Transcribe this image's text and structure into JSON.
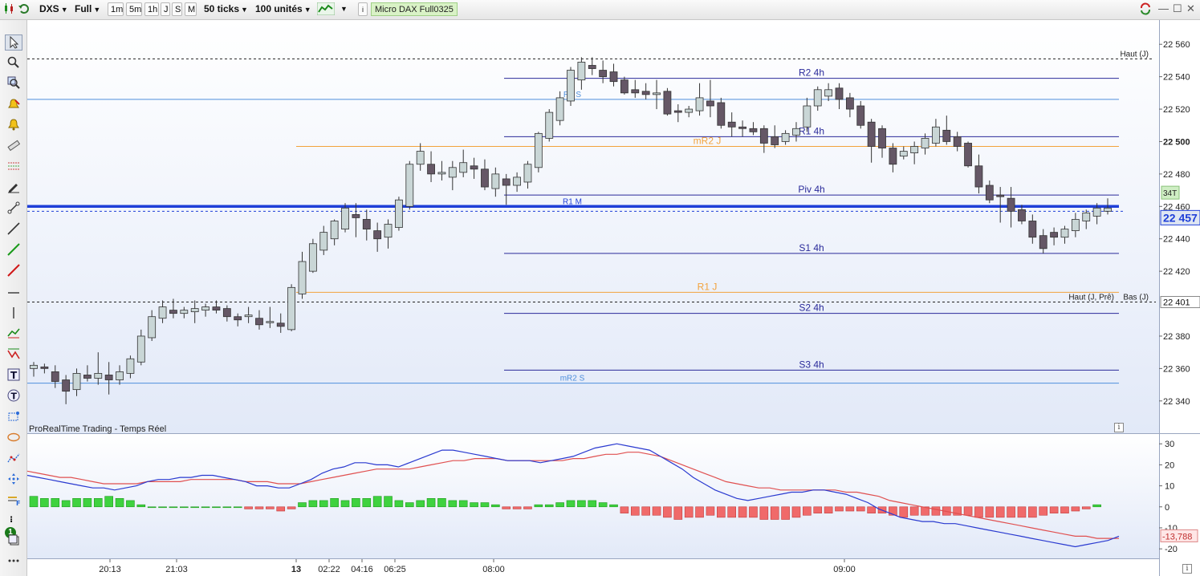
{
  "toolbar": {
    "symbol": "DXS",
    "range": "Full",
    "timeframes": [
      "1m",
      "5m",
      "1h",
      "J",
      "S",
      "M"
    ],
    "ticks": "50 ticks",
    "units": "100 unités",
    "instrument": "Micro DAX Full0325"
  },
  "chart": {
    "footer_label": "ProRealTime Trading - Temps Réel",
    "price_axis": {
      "ticks": [
        "22 560",
        "22 540",
        "22 520",
        "22 500",
        "22 480",
        "22 460",
        "22 440",
        "22 420",
        "22 380",
        "22 360",
        "22 340"
      ],
      "ymin": 22330,
      "ymax": 22570
    },
    "current_price": "22 457",
    "countdown": "34T",
    "low_marker": "22 401",
    "time_labels": [
      "20:13",
      "21:03",
      "13",
      "02:22",
      "04:16",
      "06:25",
      "08:00",
      "09:00"
    ],
    "levels": [
      {
        "label": "Haut (J)",
        "value": 22551,
        "color": "#222222",
        "style": "dashed"
      },
      {
        "label": "R2 4h",
        "value": 22539,
        "color": "#2a2a9a",
        "style": "solid"
      },
      {
        "label": "R2 S",
        "value": 22526,
        "color": "#4f8fdc",
        "style": "solid"
      },
      {
        "label": "R1 4h",
        "value": 22503,
        "color": "#2a2a9a",
        "style": "solid"
      },
      {
        "label": "mR2 J",
        "value": 22497,
        "color": "#f2a23c",
        "style": "solid"
      },
      {
        "label": "Piv 4h",
        "value": 22467,
        "color": "#2a2a9a",
        "style": "solid"
      },
      {
        "label": "R1 M",
        "value": 22460,
        "color": "#1f3fd8",
        "style": "thick"
      },
      {
        "label": "",
        "value": 22457,
        "color": "#1f3fd8",
        "style": "dashed"
      },
      {
        "label": "S1 4h",
        "value": 22431,
        "color": "#2a2a9a",
        "style": "solid"
      },
      {
        "label": "R1 J",
        "value": 22407,
        "color": "#f2a23c",
        "style": "solid"
      },
      {
        "label": "Haut (J, Prê)",
        "value": 22401,
        "color": "#222222",
        "style": "dashed"
      },
      {
        "label": "Bas (J)",
        "value": 22401,
        "color": "#222222",
        "style": "dashed"
      },
      {
        "label": "S2 4h",
        "value": 22394,
        "color": "#2a2a9a",
        "style": "solid"
      },
      {
        "label": "S3 4h",
        "value": 22359,
        "color": "#2a2a9a",
        "style": "solid"
      },
      {
        "label": "mR2 S",
        "value": 22351,
        "color": "#4f8fdc",
        "style": "solid"
      }
    ]
  },
  "indicator": {
    "axis_ticks": [
      "30",
      "20",
      "10",
      "0",
      "-10",
      "-20"
    ],
    "current_value": "-13,788",
    "ymin": -23,
    "ymax": 32
  },
  "chart_data": {
    "type": "candlestick",
    "ohlc": [
      [
        22360,
        22364,
        22355,
        22362
      ],
      [
        22361,
        22363,
        22357,
        22360
      ],
      [
        22358,
        22362,
        22348,
        22352
      ],
      [
        22353,
        22356,
        22338,
        22346
      ],
      [
        22347,
        22360,
        22343,
        22357
      ],
      [
        22356,
        22362,
        22352,
        22354
      ],
      [
        22354,
        22370,
        22350,
        22357
      ],
      [
        22356,
        22364,
        22344,
        22353
      ],
      [
        22353,
        22362,
        22350,
        22358
      ],
      [
        22357,
        22368,
        22354,
        22366
      ],
      [
        22364,
        22384,
        22362,
        22380
      ],
      [
        22379,
        22396,
        22377,
        22392
      ],
      [
        22391,
        22402,
        22388,
        22398
      ],
      [
        22396,
        22403,
        22391,
        22394
      ],
      [
        22394,
        22398,
        22391,
        22396
      ],
      [
        22395,
        22402,
        22388,
        22397
      ],
      [
        22396,
        22400,
        22392,
        22398
      ],
      [
        22398,
        22402,
        22394,
        22396
      ],
      [
        22397,
        22399,
        22389,
        22392
      ],
      [
        22392,
        22394,
        22386,
        22390
      ],
      [
        22392,
        22398,
        22388,
        22393
      ],
      [
        22391,
        22396,
        22384,
        22387
      ],
      [
        22389,
        22398,
        22385,
        22389
      ],
      [
        22388,
        22394,
        22382,
        22386
      ],
      [
        22384,
        22412,
        22383,
        22410
      ],
      [
        22406,
        22432,
        22403,
        22426
      ],
      [
        22420,
        22440,
        22419,
        22437
      ],
      [
        22433,
        22448,
        22430,
        22444
      ],
      [
        22440,
        22452,
        22436,
        22451
      ],
      [
        22446,
        22462,
        22444,
        22459
      ],
      [
        22455,
        22462,
        22441,
        22453
      ],
      [
        22452,
        22458,
        22439,
        22446
      ],
      [
        22445,
        22450,
        22432,
        22440
      ],
      [
        22441,
        22452,
        22434,
        22449
      ],
      [
        22447,
        22466,
        22445,
        22464
      ],
      [
        22460,
        22488,
        22458,
        22486
      ],
      [
        22486,
        22499,
        22482,
        22494
      ],
      [
        22486,
        22494,
        22475,
        22480
      ],
      [
        22480,
        22488,
        22476,
        22481
      ],
      [
        22478,
        22488,
        22470,
        22484
      ],
      [
        22481,
        22495,
        22478,
        22487
      ],
      [
        22485,
        22490,
        22477,
        22483
      ],
      [
        22483,
        22489,
        22470,
        22472
      ],
      [
        22471,
        22484,
        22466,
        22480
      ],
      [
        22477,
        22480,
        22461,
        22473
      ],
      [
        22473,
        22481,
        22469,
        22478
      ],
      [
        22475,
        22488,
        22471,
        22486
      ],
      [
        22484,
        22506,
        22481,
        22505
      ],
      [
        22502,
        22520,
        22500,
        22518
      ],
      [
        22513,
        22531,
        22510,
        22527
      ],
      [
        22525,
        22546,
        22522,
        22544
      ],
      [
        22538,
        22552,
        22532,
        22549
      ],
      [
        22547,
        22552,
        22541,
        22545
      ],
      [
        22544,
        22550,
        22536,
        22540
      ],
      [
        22543,
        22548,
        22534,
        22537
      ],
      [
        22538,
        22540,
        22529,
        22530
      ],
      [
        22532,
        22538,
        22527,
        22530
      ],
      [
        22531,
        22536,
        22526,
        22529
      ],
      [
        22529,
        22538,
        22520,
        22530
      ],
      [
        22531,
        22533,
        22516,
        22517
      ],
      [
        22519,
        22523,
        22512,
        22518
      ],
      [
        22518,
        22522,
        22515,
        22520
      ],
      [
        22519,
        22536,
        22516,
        22527
      ],
      [
        22525,
        22538,
        22515,
        22522
      ],
      [
        22524,
        22527,
        22508,
        22510
      ],
      [
        22512,
        22518,
        22503,
        22509
      ],
      [
        22509,
        22513,
        22503,
        22508
      ],
      [
        22508,
        22512,
        22504,
        22506
      ],
      [
        22508,
        22510,
        22493,
        22499
      ],
      [
        22503,
        22510,
        22496,
        22498
      ],
      [
        22500,
        22507,
        22498,
        22505
      ],
      [
        22504,
        22512,
        22500,
        22508
      ],
      [
        22509,
        22527,
        22506,
        22522
      ],
      [
        22522,
        22534,
        22519,
        22532
      ],
      [
        22528,
        22536,
        22525,
        22532
      ],
      [
        22533,
        22536,
        22520,
        22526
      ],
      [
        22527,
        22530,
        22515,
        22520
      ],
      [
        22522,
        22525,
        22508,
        22510
      ],
      [
        22512,
        22514,
        22487,
        22497
      ],
      [
        22508,
        22510,
        22490,
        22496
      ],
      [
        22496,
        22499,
        22481,
        22486
      ],
      [
        22491,
        22497,
        22489,
        22494
      ],
      [
        22493,
        22500,
        22486,
        22497
      ],
      [
        22496,
        22505,
        22492,
        22502
      ],
      [
        22499,
        22514,
        22497,
        22509
      ],
      [
        22507,
        22516,
        22498,
        22500
      ],
      [
        22503,
        22506,
        22494,
        22497
      ],
      [
        22499,
        22500,
        22484,
        22485
      ],
      [
        22485,
        22492,
        22468,
        22472
      ],
      [
        22473,
        22476,
        22462,
        22464
      ],
      [
        22467,
        22472,
        22450,
        22466
      ],
      [
        22465,
        22472,
        22447,
        22457
      ],
      [
        22458,
        22461,
        22449,
        22451
      ],
      [
        22451,
        22455,
        22437,
        22441
      ],
      [
        22442,
        22446,
        22431,
        22434
      ],
      [
        22444,
        22447,
        22436,
        22441
      ],
      [
        22441,
        22448,
        22437,
        22446
      ],
      [
        22445,
        22456,
        22441,
        22452
      ],
      [
        22451,
        22458,
        22446,
        22456
      ],
      [
        22454,
        22462,
        22449,
        22459
      ],
      [
        22457,
        22465,
        22455,
        22459
      ]
    ],
    "macd": [
      5,
      4,
      4,
      3,
      4,
      4,
      4,
      5,
      4,
      3,
      1,
      0,
      0,
      0,
      0,
      0,
      0,
      0,
      0,
      0,
      -1,
      -1,
      -1,
      -2,
      -1,
      2,
      3,
      3,
      4,
      3,
      4,
      4,
      5,
      5,
      3,
      2,
      3,
      4,
      4,
      3,
      3,
      2,
      2,
      1,
      -1,
      -1,
      -1,
      1,
      1,
      2,
      3,
      3,
      3,
      2,
      1,
      -3,
      -4,
      -4,
      -4,
      -5,
      -6,
      -5,
      -5,
      -4,
      -5,
      -5,
      -5,
      -5,
      -6,
      -6,
      -6,
      -5,
      -4,
      -3,
      -3,
      -2,
      -2,
      -2,
      -3,
      -3,
      -4,
      -5,
      -4,
      -4,
      -4,
      -4,
      -4,
      -4,
      -5,
      -5,
      -5,
      -5,
      -5,
      -5,
      -4,
      -3,
      -3,
      -2,
      -1,
      1
    ],
    "line_blue": [
      15,
      14,
      13,
      12,
      11,
      10,
      9,
      9,
      8,
      9,
      10,
      12,
      13,
      13,
      14,
      14,
      15,
      15,
      14,
      13,
      12,
      10,
      10,
      9,
      9,
      11,
      13,
      16,
      18,
      19,
      21,
      21,
      20,
      20,
      19,
      21,
      23,
      25,
      27,
      27,
      26,
      25,
      24,
      23,
      22,
      22,
      22,
      21,
      22,
      23,
      24,
      26,
      28,
      29,
      30,
      29,
      28,
      27,
      24,
      21,
      18,
      14,
      11,
      8,
      6,
      4,
      3,
      4,
      5,
      6,
      7,
      7,
      8,
      8,
      7,
      6,
      4,
      2,
      -1,
      -3,
      -5,
      -6,
      -7,
      -7,
      -8,
      -8,
      -9,
      -10,
      -11,
      -12,
      -13,
      -14,
      -15,
      -16,
      -17,
      -18,
      -19,
      -18,
      -17,
      -16,
      -14
    ],
    "line_red": [
      17,
      16,
      15,
      14,
      14,
      13,
      12,
      11,
      11,
      11,
      11,
      12,
      12,
      12,
      12,
      13,
      13,
      13,
      13,
      13,
      12,
      12,
      12,
      11,
      11,
      11,
      12,
      13,
      14,
      15,
      16,
      17,
      18,
      18,
      18,
      18,
      19,
      20,
      21,
      22,
      22,
      23,
      23,
      23,
      22,
      22,
      22,
      22,
      22,
      22,
      23,
      23,
      24,
      25,
      25,
      26,
      26,
      25,
      24,
      22,
      20,
      18,
      16,
      14,
      12,
      11,
      10,
      9,
      9,
      8,
      8,
      8,
      8,
      8,
      8,
      7,
      7,
      6,
      5,
      3,
      2,
      1,
      0,
      -1,
      -2,
      -3,
      -4,
      -5,
      -6,
      -7,
      -8,
      -9,
      -10,
      -11,
      -12,
      -13,
      -14,
      -14,
      -15,
      -15,
      -15
    ]
  }
}
